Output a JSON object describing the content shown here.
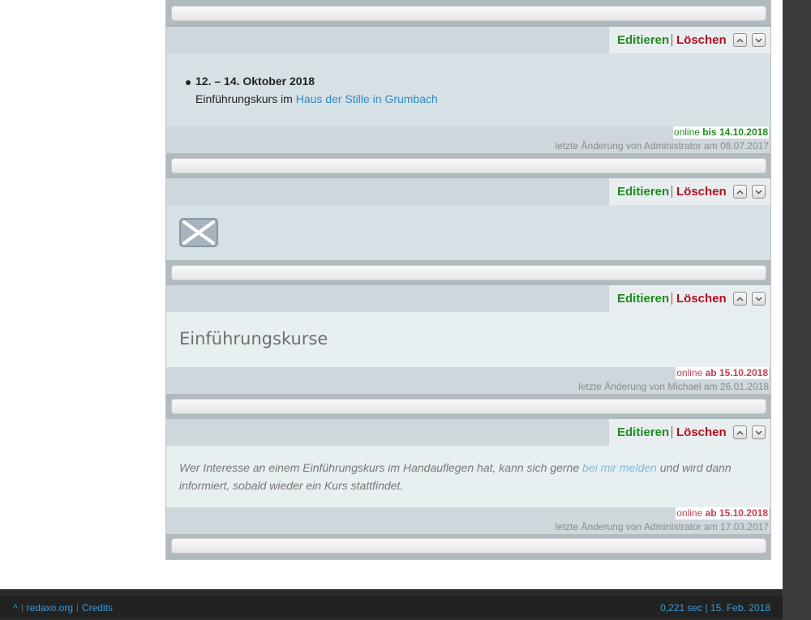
{
  "slices": [
    {
      "actions": {
        "edit": "Editieren",
        "delete": "Löschen"
      },
      "event": {
        "date": "12. – 14. Oktober 2018",
        "desc_prefix": "Einführungskurs im ",
        "desc_link": "Haus der Stille in Grumbach"
      },
      "status": {
        "label": "online",
        "detail": "bis 14.10.2018"
      },
      "changed": "letzte Änderung von Administrator am 08.07.2017"
    },
    {
      "actions": {
        "edit": "Editieren",
        "delete": "Löschen"
      },
      "image": "broken-image-icon"
    },
    {
      "actions": {
        "edit": "Editieren",
        "delete": "Löschen"
      },
      "heading": "Einführungskurse",
      "status": {
        "label": "online",
        "detail": "ab 15.10.2018"
      },
      "changed": "letzte Änderung von Michael am 26.01.2018"
    },
    {
      "actions": {
        "edit": "Editieren",
        "delete": "Löschen"
      },
      "text_prefix": "Wer Interesse an einem Einführungskurs im Handauflegen hat, kann sich gerne ",
      "text_link": "bei mir melden",
      "text_suffix": " und wird dann informiert, sobald wieder ein Kurs stattfindet.",
      "status": {
        "label": "online",
        "detail": "ab 15.10.2018"
      },
      "changed": "letzte Änderung von Administrator am 17.03.2017"
    }
  ],
  "footer": {
    "top_link": "^",
    "redaxo_link": "redaxo.org",
    "credits_link": "Credits",
    "stats": "0,221 sec | 15. Feb. 2018"
  },
  "colors": {
    "edit": "#1e8a1e",
    "delete": "#b01020",
    "online_scheduled_end": "#1e8a1e",
    "online_scheduled_start": "#c33f55",
    "link": "#2f8ac4"
  }
}
